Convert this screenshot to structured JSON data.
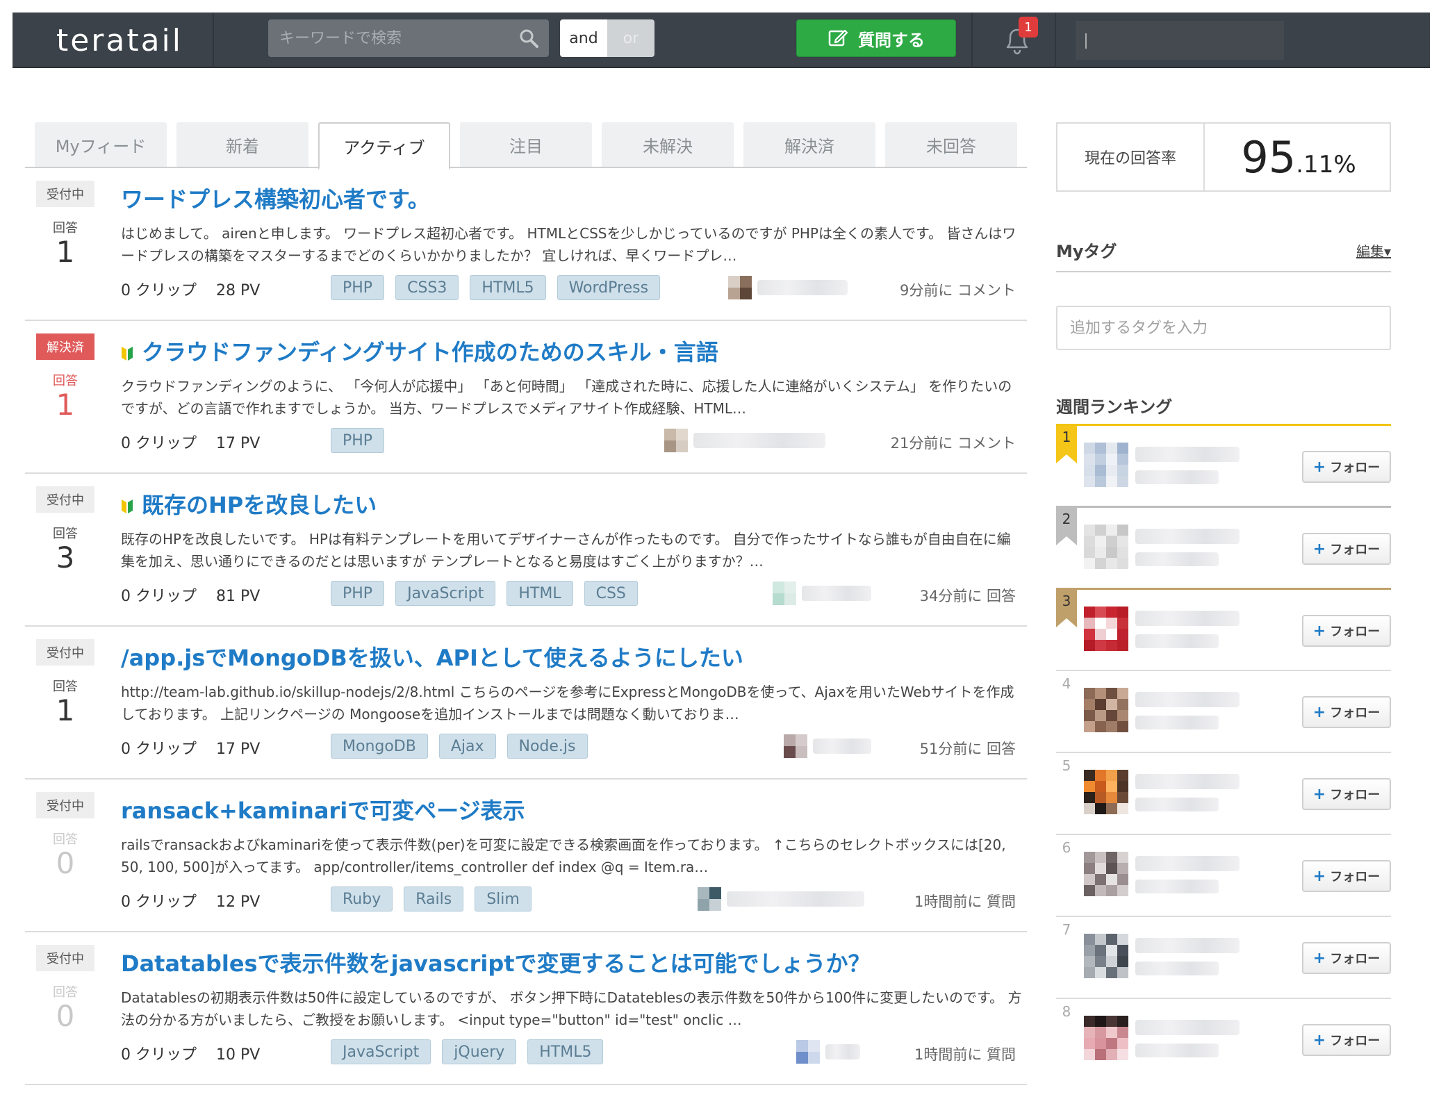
{
  "header": {
    "logo": "teratail",
    "search_placeholder": "キーワードで検索",
    "and_label": "and",
    "or_label": "or",
    "ask_label": "質問する",
    "notification_count": "1"
  },
  "tabs": [
    "Myフィード",
    "新着",
    "アクティブ",
    "注目",
    "未解決",
    "解決済",
    "未回答"
  ],
  "active_tab": "アクティブ",
  "questions": [
    {
      "status": "受付中",
      "answers_label": "回答",
      "answers": "1",
      "title": "ワードプレス構築初心者です。",
      "body": "はじめまして。 airenと申します。 ワードプレス超初心者です。 HTMLとCSSを少しかじっているのですが PHPは全くの素人です。 皆さんはワードプレスの構築をマスターするまでどのくらいかかりましたか？ 宜しければ、早くワードプレ…",
      "clips": "0 クリップ",
      "pv": "28 PV",
      "tags": [
        "PHP",
        "CSS3",
        "HTML5",
        "WordPress"
      ],
      "meta": "9分前に コメント"
    },
    {
      "status": "解決済",
      "answers_label": "回答",
      "answers": "1",
      "title": "クラウドファンディングサイト作成のためのスキル・言語",
      "body": "クラウドファンディングのように、 「今何人が応援中」 「あと何時間」 「達成された時に、応援した人に連絡がいくシステム」 を作りたいのですが、どの言語で作れますでしょうか。 当方、ワードプレスでメディアサイト作成経験、HTML…",
      "clips": "0 クリップ",
      "pv": "17 PV",
      "tags": [
        "PHP"
      ],
      "meta": "21分前に コメント"
    },
    {
      "status": "受付中",
      "answers_label": "回答",
      "answers": "3",
      "title": "既存のHPを改良したい",
      "body": "既存のHPを改良したいです。 HPは有料テンプレートを用いてデザイナーさんが作ったものです。 自分で作ったサイトなら誰もが自由自在に編集を加え、思い通りにできるのだとは思いますが テンプレートとなると易度はすごく上がりますか？…",
      "clips": "0 クリップ",
      "pv": "81 PV",
      "tags": [
        "PHP",
        "JavaScript",
        "HTML",
        "CSS"
      ],
      "meta": "34分前に 回答"
    },
    {
      "status": "受付中",
      "answers_label": "回答",
      "answers": "1",
      "title": "/app.jsでMongoDBを扱い、APIとして使えるようにしたい",
      "body": "http://team-lab.github.io/skillup-nodejs/2/8.html こちらのページを参考にExpressとMongoDBを使って、Ajaxを用いたWebサイトを作成しております。 上記リンクページの Mongooseを追加インストールまでは問題なく動いておりま…",
      "clips": "0 クリップ",
      "pv": "17 PV",
      "tags": [
        "MongoDB",
        "Ajax",
        "Node.js"
      ],
      "meta": "51分前に 回答"
    },
    {
      "status": "受付中",
      "answers_label": "回答",
      "answers": "0",
      "title": "ransack+kaminariで可変ページ表示",
      "body": "railsでransackおよびkaminariを使って表示件数(per)を可変に設定できる検索画面を作っております。 ↑こちらのセレクトボックスには[20, 50, 100, 500]が入ってます。 app/controller/items_controller def index @q = Item.ra…",
      "clips": "0 クリップ",
      "pv": "12 PV",
      "tags": [
        "Ruby",
        "Rails",
        "Slim"
      ],
      "meta": "1時間前に 質問"
    },
    {
      "status": "受付中",
      "answers_label": "回答",
      "answers": "0",
      "title": "Datatablesで表示件数をjavascriptで変更することは可能でしょうか？",
      "body": "Datatablesの初期表示件数は50件に設定しているのですが、 ボタン押下時にDatateblesの表示件数を50件から100件に変更したいのです。 方法の分かる方がいましたら、ご教授をお願いします。 <input type=\"button\" id=\"test\" onclic …",
      "clips": "0 クリップ",
      "pv": "10 PV",
      "tags": [
        "JavaScript",
        "jQuery",
        "HTML5"
      ],
      "meta": "1時間前に 質問"
    }
  ],
  "sidebar": {
    "answer_rate_label": "現在の回答率",
    "answer_rate_int": "95",
    "answer_rate_dec": ".11%",
    "mytag_title": "Myタグ",
    "mytag_edit": "編集▾",
    "tag_input_placeholder": "追加するタグを入力",
    "ranking_title": "週間ランキング",
    "follow_label": "フォロー",
    "ranks": [
      "1",
      "2",
      "3",
      "4",
      "5",
      "6",
      "7",
      "8"
    ]
  },
  "colors": {
    "header_bg": "#3b4249",
    "brand_green": "#2eaa45",
    "title_blue": "#1f7bc6",
    "solved_red": "#e05a5a",
    "tag_bg": "#cfe0ea"
  }
}
